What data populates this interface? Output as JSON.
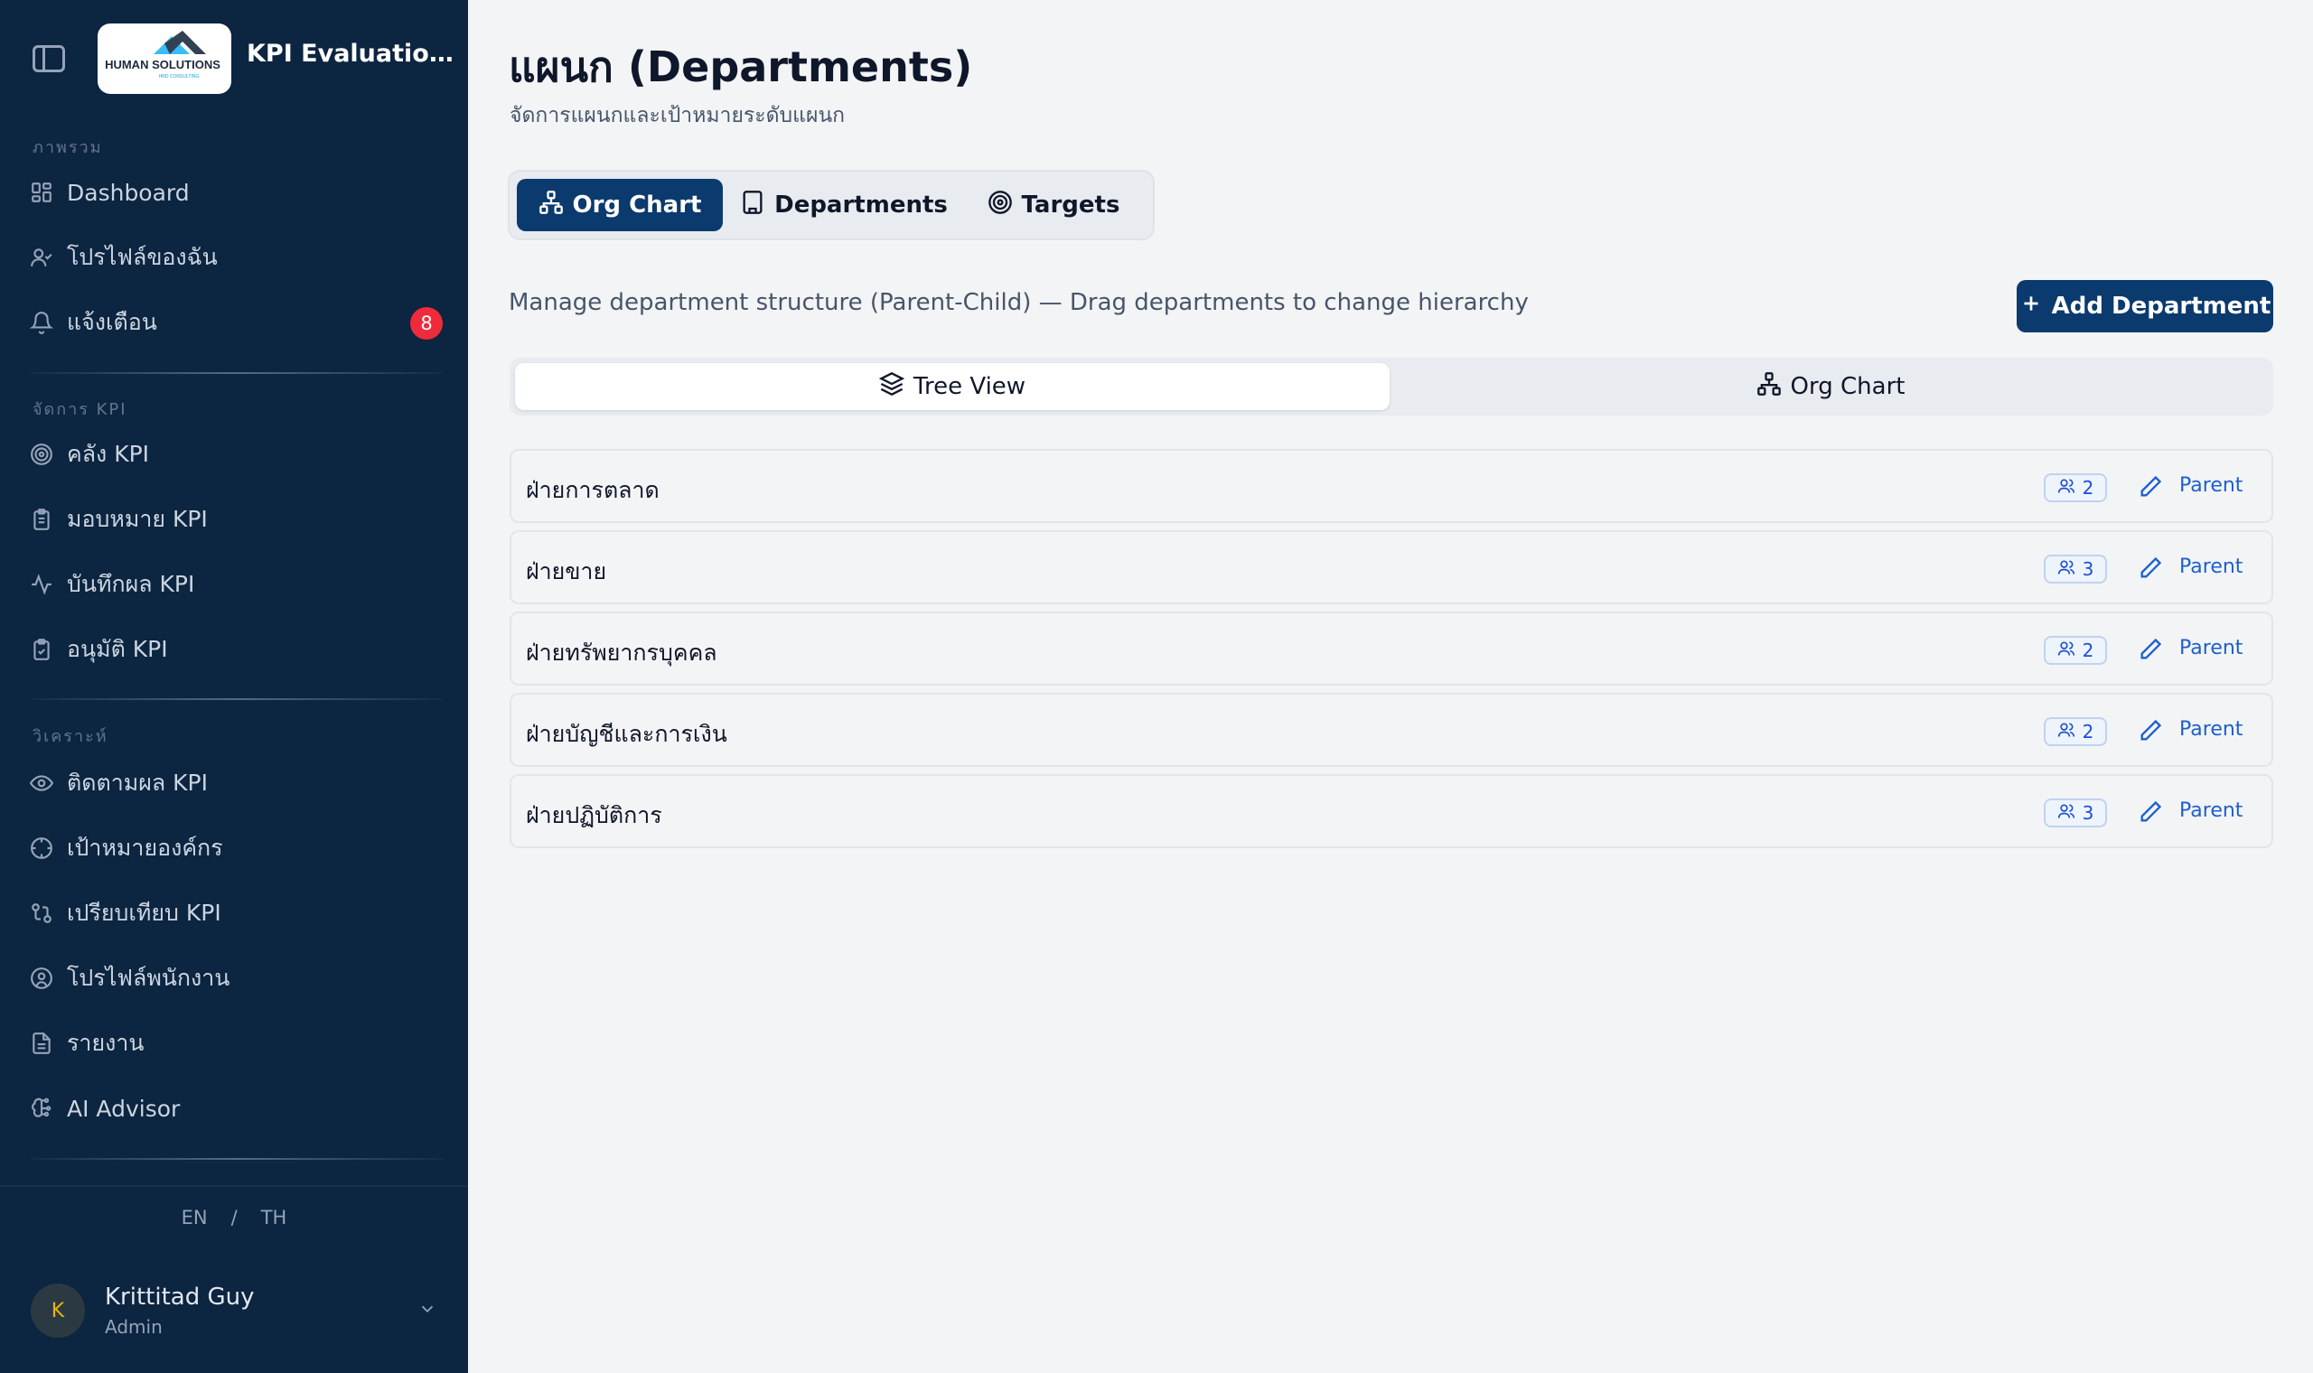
{
  "app": {
    "title": "KPI Evaluation ...",
    "logo_text": "HUMAN SOLUTIONS",
    "logo_sub": "HRD CONSULTING"
  },
  "sidebar": {
    "sections": [
      {
        "label": "ภาพรวม",
        "items": [
          {
            "label": "Dashboard",
            "icon": "dashboard-icon"
          },
          {
            "label": "โปรไฟล์ของฉัน",
            "icon": "user-icon"
          },
          {
            "label": "แจ้งเตือน",
            "icon": "bell-icon",
            "badge": "8"
          }
        ]
      },
      {
        "label": "จัดการ KPI",
        "items": [
          {
            "label": "คลัง KPI",
            "icon": "target-icon"
          },
          {
            "label": "มอบหมาย KPI",
            "icon": "clipboard-list-icon"
          },
          {
            "label": "บันทึกผล KPI",
            "icon": "activity-icon"
          },
          {
            "label": "อนุมัติ KPI",
            "icon": "clipboard-check-icon"
          }
        ]
      },
      {
        "label": "วิเคราะห์",
        "items": [
          {
            "label": "ติดตามผล KPI",
            "icon": "eye-icon"
          },
          {
            "label": "เป้าหมายองค์กร",
            "icon": "crosshair-icon"
          },
          {
            "label": "เปรียบเทียบ KPI",
            "icon": "compare-icon"
          },
          {
            "label": "โปรไฟล์พนักงาน",
            "icon": "user-circle-icon"
          },
          {
            "label": "รายงาน",
            "icon": "file-text-icon"
          },
          {
            "label": "AI Advisor",
            "icon": "brain-icon"
          }
        ]
      }
    ],
    "lang": {
      "en": "EN",
      "sep": "/",
      "th": "TH"
    },
    "user": {
      "initial": "K",
      "name": "Krittitad Guy",
      "role": "Admin"
    }
  },
  "main": {
    "title": "แผนก (Departments)",
    "subtitle": "จัดการแผนกและเป้าหมายระดับแผนก",
    "tabs": [
      {
        "label": "Org Chart",
        "active": true,
        "icon": "org-chart-icon"
      },
      {
        "label": "Departments",
        "active": false,
        "icon": "building-icon"
      },
      {
        "label": "Targets",
        "active": false,
        "icon": "target-icon"
      }
    ],
    "description": "Manage department structure (Parent-Child) — Drag departments to change hierarchy",
    "add_button": "Add Department",
    "view_toggle": [
      {
        "label": "Tree View",
        "active": true,
        "icon": "layers-icon"
      },
      {
        "label": "Org Chart",
        "active": false,
        "icon": "org-chart-icon"
      }
    ],
    "departments": [
      {
        "name": "ฝ่ายการตลาด",
        "count": "2",
        "action": "Parent"
      },
      {
        "name": "ฝ่ายขาย",
        "count": "3",
        "action": "Parent"
      },
      {
        "name": "ฝ่ายทรัพยากรบุคคล",
        "count": "2",
        "action": "Parent"
      },
      {
        "name": "ฝ่ายบัญชีและการเงิน",
        "count": "2",
        "action": "Parent"
      },
      {
        "name": "ฝ่ายปฏิบัติการ",
        "count": "3",
        "action": "Parent"
      }
    ]
  },
  "colors": {
    "sidebar_bg": "#0c2540",
    "primary": "#0b3a6e",
    "badge": "#ef2b3b",
    "link": "#1d5fd0"
  }
}
